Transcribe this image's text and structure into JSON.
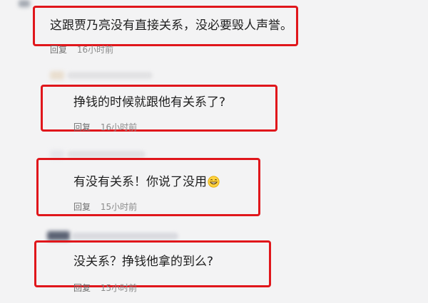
{
  "comments": [
    {
      "text": "这跟贾乃亮没有直接关系，没必要毁人声誉。",
      "reply_label": "回复",
      "time": "16小时前"
    },
    {
      "text": "挣钱的时候就跟他有关系了?",
      "reply_label": "回复",
      "time": "16小时前"
    },
    {
      "text": "有没有关系！你说了没用",
      "emoji": "grinning-face-icon",
      "reply_label": "回复",
      "time": "15小时前"
    },
    {
      "text": "没关系？挣钱他拿的到么?",
      "reply_label": "回复",
      "time": "15小时前"
    }
  ],
  "colors": {
    "highlight_border": "#e0161b",
    "background": "#f3f3f4",
    "meta_text": "#8a8a8a"
  }
}
